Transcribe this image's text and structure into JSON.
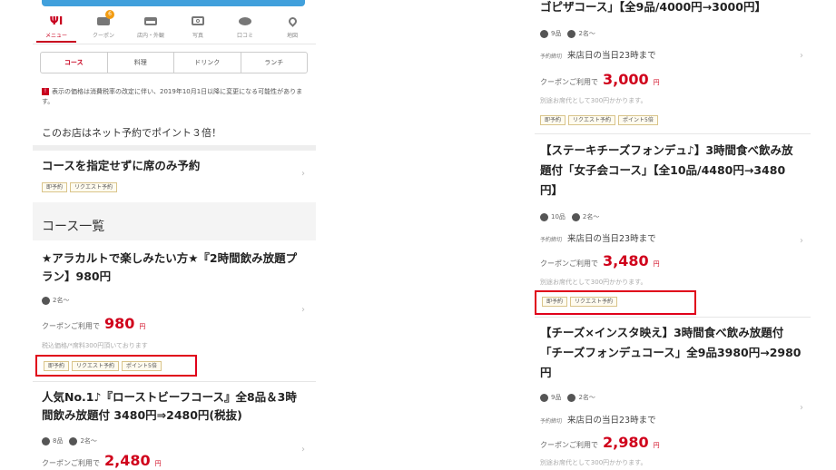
{
  "left": {
    "nav": [
      {
        "label": "メニュー",
        "icon": "fork-knife-icon",
        "active": true
      },
      {
        "label": "クーポン",
        "icon": "coupon-icon",
        "badge": "6"
      },
      {
        "label": "店内・外観",
        "icon": "sofa-icon"
      },
      {
        "label": "写真",
        "icon": "camera-icon"
      },
      {
        "label": "口コミ",
        "icon": "comment-icon"
      },
      {
        "label": "地図",
        "icon": "map-pin-icon"
      }
    ],
    "tabs": [
      "コース",
      "料理",
      "ドリンク",
      "ランチ"
    ],
    "notice": "表示の価格は消費税率の改定に伴い、2019年10月1日以降に変更になる可能性があります。",
    "notice_mark": "!",
    "point_msg": "このお店はネット予約でポイント３倍！",
    "seat_only": {
      "title": "コースを指定せずに席のみ予約",
      "tags": [
        "即予約",
        "リクエスト予約"
      ]
    },
    "section_title": "コース一覧",
    "courses": [
      {
        "title": "★アラカルトで楽しみたい方★『2時間飲み放題プラン】980円",
        "people": "2名〜",
        "coupon_label": "クーポンご利用で",
        "price": "980",
        "yen": "円",
        "note": "税込価格/*席料300円頂いております",
        "tags": [
          "即予約",
          "リクエスト予約",
          "ポイント5倍"
        ]
      },
      {
        "title": "人気No.1♪『ローストビーフコース』全8品＆3時間飲み放題付 3480円⇒2480円(税抜)",
        "items": "8品",
        "people": "2名〜",
        "coupon_label": "クーポンご利用で",
        "price": "2,480",
        "yen": "円"
      }
    ]
  },
  "right": {
    "courses": [
      {
        "title": "ゴピザコース」【全9品/4000円→3000円】",
        "items": "9品",
        "people": "2名〜",
        "deadline_label": "予約締切",
        "deadline": "来店日の当日23時まで",
        "coupon_label": "クーポンご利用で",
        "price": "3,000",
        "yen": "円",
        "note": "別途お席代として300円かかります。",
        "tags": [
          "即予約",
          "リクエスト予約",
          "ポイント5倍"
        ]
      },
      {
        "title": "【ステーキチーズフォンデュ♪】3時間食べ飲み放題付「女子会コース」【全10品/4480円→3480円】",
        "items": "10品",
        "people": "2名〜",
        "deadline_label": "予約締切",
        "deadline": "来店日の当日23時まで",
        "coupon_label": "クーポンご利用で",
        "price": "3,480",
        "yen": "円",
        "note": "別途お席代として300円かかります。",
        "tags": [
          "即予約",
          "リクエスト予約"
        ]
      },
      {
        "title": "【チーズ×インスタ映え】3時間食べ飲み放題付「チーズフォンデュコース」全9品3980円→2980円",
        "items": "9品",
        "people": "2名〜",
        "deadline_label": "予約締切",
        "deadline": "来店日の当日23時まで",
        "coupon_label": "クーポンご利用で",
        "price": "2,980",
        "yen": "円",
        "note": "別途お席代として300円かかります。"
      }
    ]
  },
  "colors": {
    "accent": "#c8001e",
    "price": "#d0021b",
    "highlight": "#e0001a",
    "topbar": "#41a0dc"
  }
}
